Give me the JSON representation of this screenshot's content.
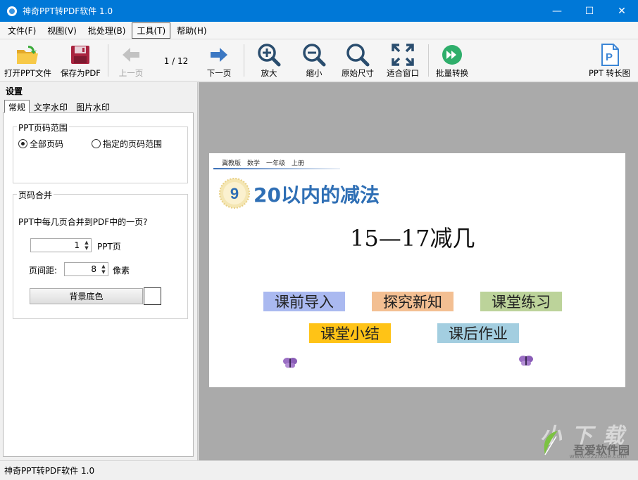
{
  "window": {
    "title": "神奇PPT转PDF软件 1.0",
    "minimize": "—",
    "maximize": "☐",
    "close": "✕"
  },
  "menu": [
    {
      "label": "文件(F)"
    },
    {
      "label": "视图(V)"
    },
    {
      "label": "批处理(B)"
    },
    {
      "label": "工具(T)",
      "active": true
    },
    {
      "label": "帮助(H)"
    }
  ],
  "toolbar": {
    "open_ppt": "打开PPT文件",
    "save_pdf": "保存为PDF",
    "prev_page": "上一页",
    "page_indicator": "1 / 12",
    "next_page": "下一页",
    "zoom_in": "放大",
    "zoom_out": "缩小",
    "original_size": "原始尺寸",
    "fit_window": "适合窗口",
    "batch_convert": "批量转换",
    "ppt_long_image": "PPT 转长图"
  },
  "settings": {
    "heading": "设置",
    "tabs": [
      "常规",
      "文字水印",
      "图片水印"
    ],
    "page_range": {
      "title": "PPT页码范围",
      "option_all": "全部页码",
      "option_custom": "指定的页码范围"
    },
    "merge": {
      "title": "页码合并",
      "question": "PPT中每几页合并到PDF中的一页?",
      "pages_value": "1",
      "pages_unit": "PPT页",
      "spacing_label": "页间距:",
      "spacing_value": "8",
      "spacing_unit": "像素",
      "bg_color_button": "背景底色",
      "bg_color": "#ffffff"
    }
  },
  "slide": {
    "header": [
      "冀教版",
      "数学",
      "一年级",
      "上册"
    ],
    "badge_number": "9",
    "lesson_title": "20以内的减法",
    "sub_title": "15—17减几",
    "chips": [
      {
        "label": "课前导入",
        "color": "#aab9f0"
      },
      {
        "label": "探究新知",
        "color": "#f3bf92"
      },
      {
        "label": "课堂练习",
        "color": "#bcd39a"
      },
      {
        "label": "课堂小结",
        "color": "#ffc316"
      },
      {
        "label": "课后作业",
        "color": "#a3cee0"
      }
    ]
  },
  "watermark": {
    "main": "吾爱软件园",
    "url": "www.52zixue.com",
    "ghost": "小 下 载"
  },
  "status": {
    "text": "神奇PPT转PDF软件 1.0"
  }
}
